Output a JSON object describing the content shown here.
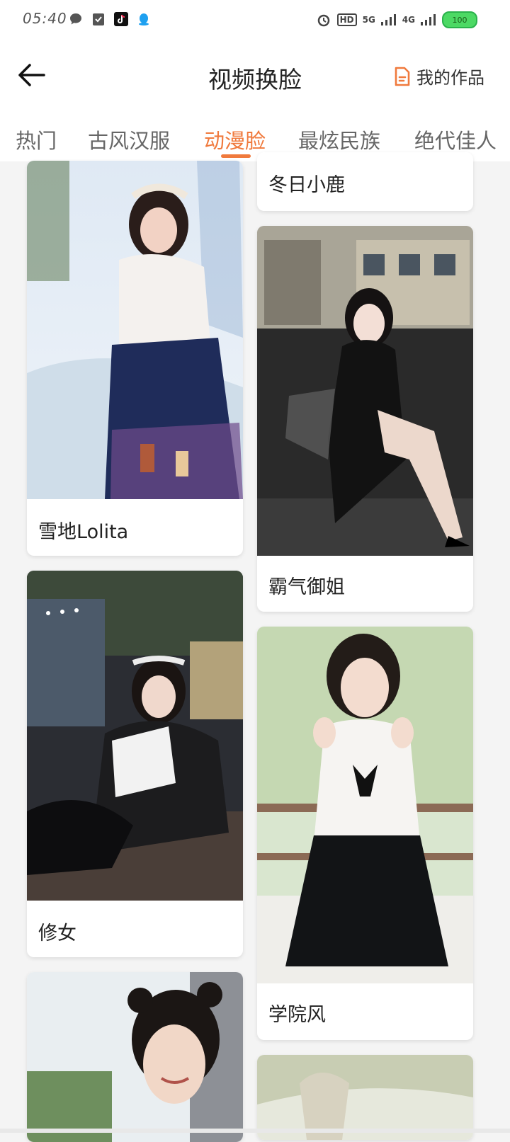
{
  "status_bar": {
    "time": "05:40",
    "battery": "100",
    "network_1": "5G",
    "network_2": "4G",
    "hd_label": "HD"
  },
  "header": {
    "title": "视频换脸",
    "works_label": "我的作品",
    "accent_color": "#f07a3d"
  },
  "tabs": [
    {
      "label": "热门"
    },
    {
      "label": "古风汉服"
    },
    {
      "label": "动漫脸"
    },
    {
      "label": "最炫民族"
    },
    {
      "label": "绝代佳人"
    }
  ],
  "active_tab": "动漫脸",
  "cards": [
    {
      "title": "冬日小鹿"
    },
    {
      "title": "雪地Lolita"
    },
    {
      "title": "霸气御姐"
    },
    {
      "title": "修女"
    },
    {
      "title": "学院风"
    },
    {
      "title": ""
    },
    {
      "title": ""
    }
  ]
}
